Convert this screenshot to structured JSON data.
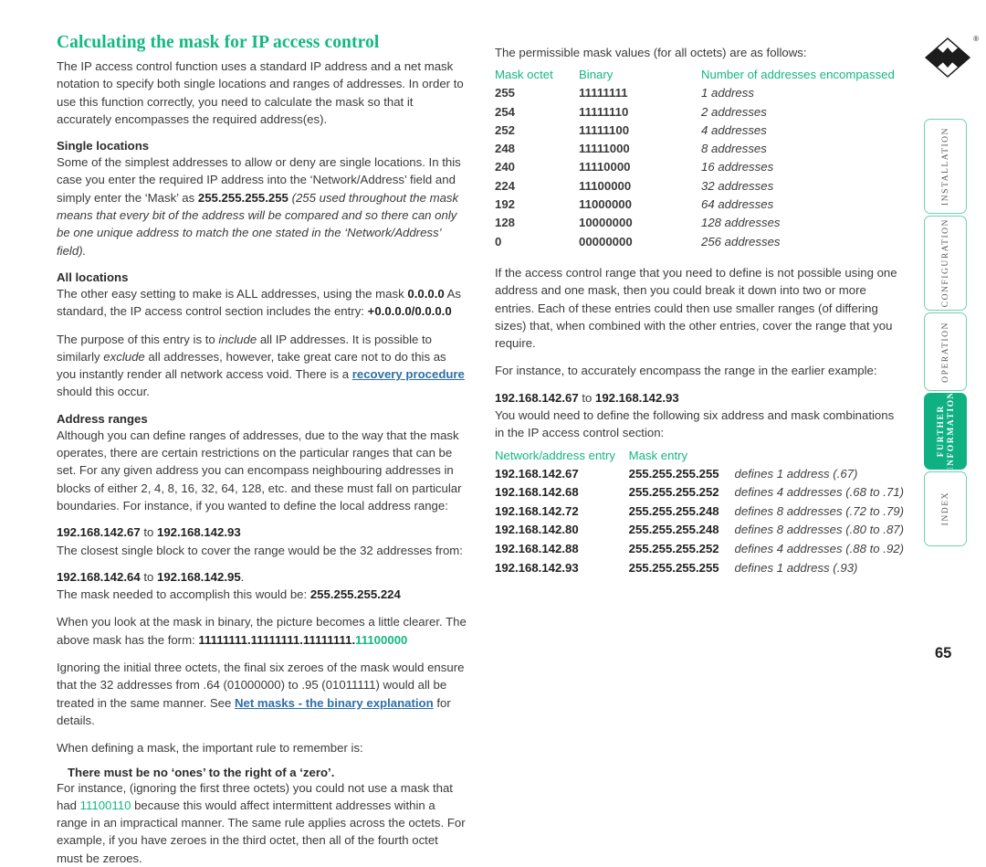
{
  "document": {
    "page_number": "65",
    "logo_registered_mark": "®"
  },
  "left_column": {
    "title": "Calculating the mask for IP access control",
    "intro": "The IP access control function uses a standard IP address and a net mask notation to specify both single locations and ranges of addresses. In order to use this function correctly, you need to calculate the mask so that it accurately encompasses the required address(es).",
    "single_locations": {
      "heading": "Single locations",
      "text_before_mask": "Some of the simplest addresses to allow or deny are single locations. In this case you enter the required IP address into the ‘Network/Address’ field and simply enter the ‘Mask’ as ",
      "mask_value": "255.255.255.255",
      "text_italic": " (255 used throughout the mask means that every bit of the address will be compared and so there can only be one unique address to match the one stated in the ‘Network/Address’ field)."
    },
    "all_locations": {
      "heading": "All locations",
      "p1_a": "The other easy setting to make is ALL addresses, using the mask ",
      "p1_mask": "0.0.0.0",
      "p1_b": "  As standard, the IP access control section includes the entry: ",
      "p1_entry": "+0.0.0.0/0.0.0.0",
      "p2_a": "The purpose of this entry is to ",
      "p2_include": "include",
      "p2_b": " all IP addresses. It is possible to similarly ",
      "p2_exclude": "exclude",
      "p2_c": " all addresses, however, take great care not to do this as you instantly render all network access void. There is a ",
      "p2_link": "recovery procedure",
      "p2_d": " should this occur."
    },
    "address_ranges": {
      "heading": "Address ranges",
      "p1": "Although you can define ranges of addresses, due to the way that the mask operates, there are certain restrictions on the particular ranges that can be set. For any given address you can encompass neighbouring addresses in blocks of either 2, 4, 8, 16, 32, 64, 128, etc. and these must fall on particular boundaries. For instance, if you wanted to define the local address range:",
      "range1_start": "192.168.142.67",
      "range1_join": " to ",
      "range1_end": "192.168.142.93",
      "p2": "The closest single block to cover the range would be the 32 addresses from:",
      "range2_start": "192.168.142.64",
      "range2_join": " to ",
      "range2_end": "192.168.142.95",
      "range2_period": ".",
      "p3_a": "The mask needed to accomplish this would be: ",
      "p3_mask": "255.255.255.224",
      "p4_a": "When you look at the mask in binary, the picture becomes a little clearer. The above mask has the form: ",
      "p4_binary_prefix": "11111111.11111111.11111111.",
      "p4_binary_suffix": "11100000",
      "p5_a": "Ignoring the initial three octets, the final six zeroes of the mask would ensure that the 32 addresses from .64 (01000000) to .95 (01011111) would all be treated in the same manner. See ",
      "p5_link": "Net masks - the binary explanation",
      "p5_b": " for details.",
      "p6": "When defining a mask, the important rule to remember is:",
      "rule": "There must be no ‘ones’ to the right of a ‘zero’.",
      "p7_a": "For instance, (ignoring the first three octets) you could not use a mask that had ",
      "p7_binary": "11100110",
      "p7_b": " because this would affect intermittent addresses within a range in an impractical manner. The same rule applies across the octets. For example, if you have zeroes in the third octet, then all of the fourth octet must be zeroes."
    }
  },
  "right_column": {
    "intro": "The permissible mask values (for all octets) are as follows:",
    "mask_table": {
      "headers": [
        "Mask octet",
        "Binary",
        "Number of addresses encompassed"
      ],
      "rows": [
        [
          "255",
          "11111111",
          "1 address"
        ],
        [
          "254",
          "11111110",
          "2 addresses"
        ],
        [
          "252",
          "11111100",
          "4 addresses"
        ],
        [
          "248",
          "11111000",
          "8 addresses"
        ],
        [
          "240",
          "11110000",
          "16 addresses"
        ],
        [
          "224",
          "11100000",
          "32 addresses"
        ],
        [
          "192",
          "11000000",
          "64 addresses"
        ],
        [
          "128",
          "10000000",
          "128 addresses"
        ],
        [
          "0",
          "00000000",
          "256 addresses"
        ]
      ]
    },
    "p1": "If the access control range that you need to define is not possible using one address and one mask, then you could break it down into two or more entries. Each of these entries could then use smaller ranges (of differing sizes) that, when combined with the other entries, cover the range that you require.",
    "p2": "For instance, to accurately encompass the range in the earlier example:",
    "range_start": "192.168.142.67",
    "range_join": " to ",
    "range_end": "192.168.142.93",
    "p3": "You would need to define the following six address and mask combinations in the IP access control section:",
    "entry_table": {
      "headers": [
        "Network/address entry",
        "Mask entry",
        ""
      ],
      "rows": [
        [
          "192.168.142.67",
          "255.255.255.255",
          "defines 1 address (.67)"
        ],
        [
          "192.168.142.68",
          "255.255.255.252",
          "defines 4 addresses (.68 to .71)"
        ],
        [
          "192.168.142.72",
          "255.255.255.248",
          "defines 8 addresses (.72 to .79)"
        ],
        [
          "192.168.142.80",
          "255.255.255.248",
          "defines 8 addresses (.80 to .87)"
        ],
        [
          "192.168.142.88",
          "255.255.255.252",
          "defines 4 addresses (.88 to .92)"
        ],
        [
          "192.168.142.93",
          "255.255.255.255",
          "defines 1 address (.93)"
        ]
      ]
    }
  },
  "sidebar": {
    "tabs": [
      {
        "label": "INSTALLATION",
        "active": false
      },
      {
        "label": "CONFIGURATION",
        "active": false
      },
      {
        "label": "OPERATION",
        "active": false
      },
      {
        "label": "FURTHER\nINFORMATION",
        "active": true
      },
      {
        "label": "INDEX",
        "active": false
      }
    ]
  },
  "colors": {
    "accent_green": "#13b880",
    "tab_active": "#0fb183",
    "tab_border": "#6fd3ad",
    "link_blue": "#2f6fa8",
    "body_text": "#3a3a3a"
  }
}
